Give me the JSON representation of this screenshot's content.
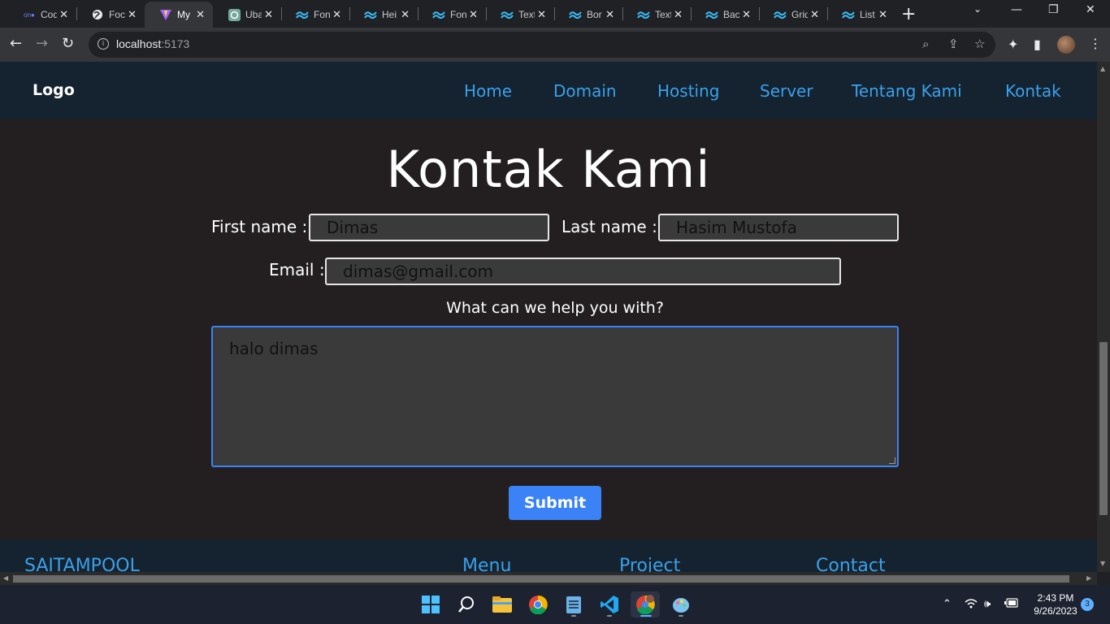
{
  "browser": {
    "tabs": [
      {
        "label": "Cod",
        "icon": "codepen-icon"
      },
      {
        "label": "Foc",
        "icon": "globe-icon"
      },
      {
        "label": "My",
        "icon": "vite-icon",
        "active": true
      },
      {
        "label": "Uba",
        "icon": "chatgpt-icon"
      },
      {
        "label": "Fon",
        "icon": "tailwind-icon"
      },
      {
        "label": "Hei",
        "icon": "tailwind-icon"
      },
      {
        "label": "Fon",
        "icon": "tailwind-icon"
      },
      {
        "label": "Text",
        "icon": "tailwind-icon"
      },
      {
        "label": "Bor",
        "icon": "tailwind-icon"
      },
      {
        "label": "Text",
        "icon": "tailwind-icon"
      },
      {
        "label": "Bac",
        "icon": "tailwind-icon"
      },
      {
        "label": "Grid",
        "icon": "tailwind-icon"
      },
      {
        "label": "List",
        "icon": "tailwind-icon"
      }
    ],
    "url_host": "localhost",
    "url_port": ":5173"
  },
  "site": {
    "logo": "Logo",
    "nav": [
      "Home",
      "Domain",
      "Hosting",
      "Server",
      "Tentang Kami",
      "Kontak"
    ],
    "accent": "#3ba0ea"
  },
  "form": {
    "title": "Kontak Kami",
    "first_name_label": "First name :",
    "first_name_value": "Dimas",
    "last_name_label": "Last name :",
    "last_name_value": "Hasim Mustofa",
    "email_label": "Email :",
    "email_value": "dimas@gmail.com",
    "question": "What can we help you with?",
    "message_value": "halo dimas",
    "submit_label": "Submit",
    "submit_color": "#3b82f6"
  },
  "footer": {
    "brand": "SAITAMPOOL",
    "menu": "Menu",
    "project": "Project",
    "contact": "Contact"
  },
  "taskbar": {
    "time": "2:43 PM",
    "date": "9/26/2023",
    "notifications": "3"
  }
}
